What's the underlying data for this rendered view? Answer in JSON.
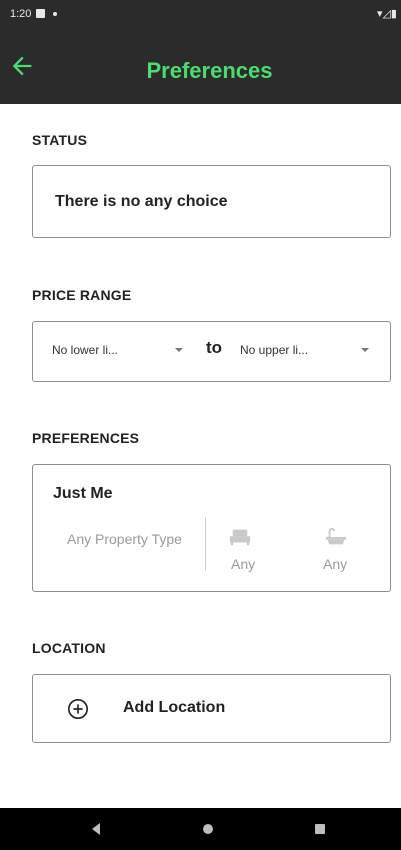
{
  "status_bar": {
    "time": "1:20",
    "system_icons": "▾◿▮"
  },
  "app_bar": {
    "title": "Preferences"
  },
  "sections": {
    "status": {
      "label": "STATUS",
      "value": "There is no any choice"
    },
    "price_range": {
      "label": "PRICE RANGE",
      "lower": "No lower li...",
      "connector": "to",
      "upper": "No upper li..."
    },
    "preferences": {
      "label": "PREFERENCES",
      "who": "Just Me",
      "property_type": "Any Property Type",
      "bedrooms": "Any",
      "bathrooms": "Any"
    },
    "location": {
      "label": "LOCATION",
      "add_label": "Add Location"
    }
  },
  "colors": {
    "appbar_bg": "#2b2b2b",
    "title_accent": "#4ddb71",
    "border": "#8f8f8f",
    "muted_text": "#9a9a9a"
  },
  "icons": {
    "back": "arrow-left-icon",
    "bed": "bed-icon",
    "bath": "bathtub-icon",
    "add": "plus-circle-icon"
  }
}
